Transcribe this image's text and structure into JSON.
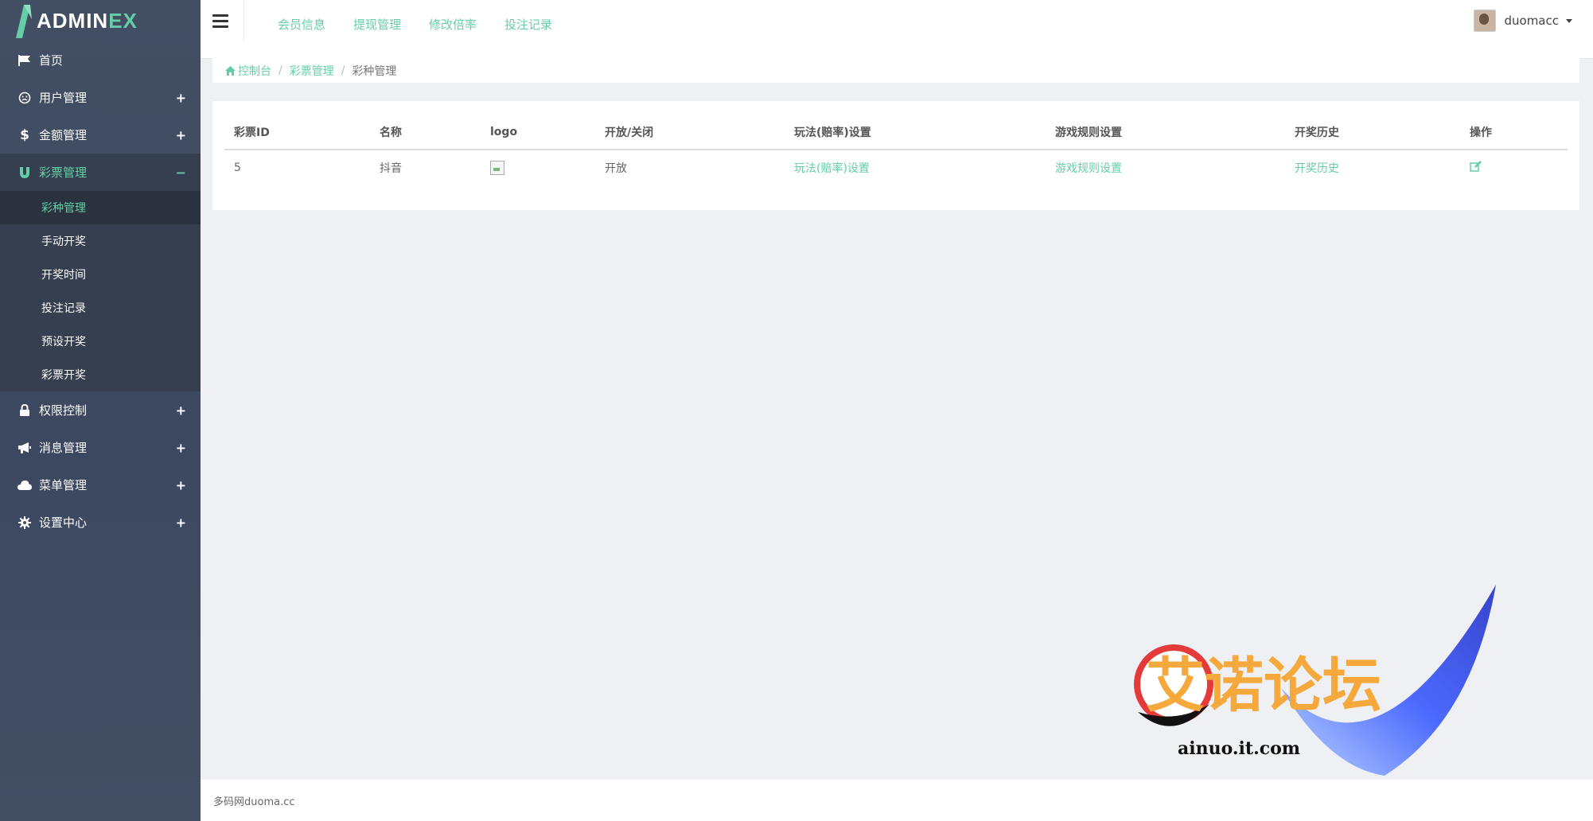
{
  "app": {
    "logo_main": "ADMIN",
    "logo_accent": "EX"
  },
  "sidebar": {
    "items": [
      {
        "label": "首页",
        "icon": "flag-icon"
      },
      {
        "label": "用户管理",
        "icon": "smile-icon",
        "toggle": "+"
      },
      {
        "label": "金额管理",
        "icon": "dollar-icon",
        "toggle": "+"
      },
      {
        "label": "彩票管理",
        "icon": "magnet-icon",
        "toggle": "−"
      },
      {
        "label": "权限控制",
        "icon": "lock-icon",
        "toggle": "+"
      },
      {
        "label": "消息管理",
        "icon": "bullhorn-icon",
        "toggle": "+"
      },
      {
        "label": "菜单管理",
        "icon": "cloud-icon",
        "toggle": "+"
      },
      {
        "label": "设置中心",
        "icon": "gear-icon",
        "toggle": "+"
      }
    ],
    "sub_items": [
      "彩种管理",
      "手动开奖",
      "开奖时间",
      "投注记录",
      "预设开奖",
      "彩票开奖"
    ]
  },
  "header": {
    "menu": [
      "会员信息",
      "提现管理",
      "修改倍率",
      "投注记录"
    ],
    "username": "duomacc"
  },
  "breadcrumb": {
    "home": "控制台",
    "parent": "彩票管理",
    "current": "彩种管理"
  },
  "table": {
    "headers": [
      "彩票ID",
      "名称",
      "logo",
      "开放/关闭",
      "玩法(赔率)设置",
      "游戏规则设置",
      "开奖历史",
      "操作"
    ],
    "rows": [
      {
        "id": "5",
        "name": "抖音",
        "status": "开放",
        "play": "玩法(赔率)设置",
        "rules": "游戏规则设置",
        "history": "开奖历史"
      }
    ]
  },
  "footer": {
    "text": "多码网duoma.cc"
  },
  "watermark": {
    "title": "艾诺论坛",
    "url": "ainuo.it.com"
  },
  "colors": {
    "accent": "#65cea7",
    "sidebar": "#424f63"
  }
}
